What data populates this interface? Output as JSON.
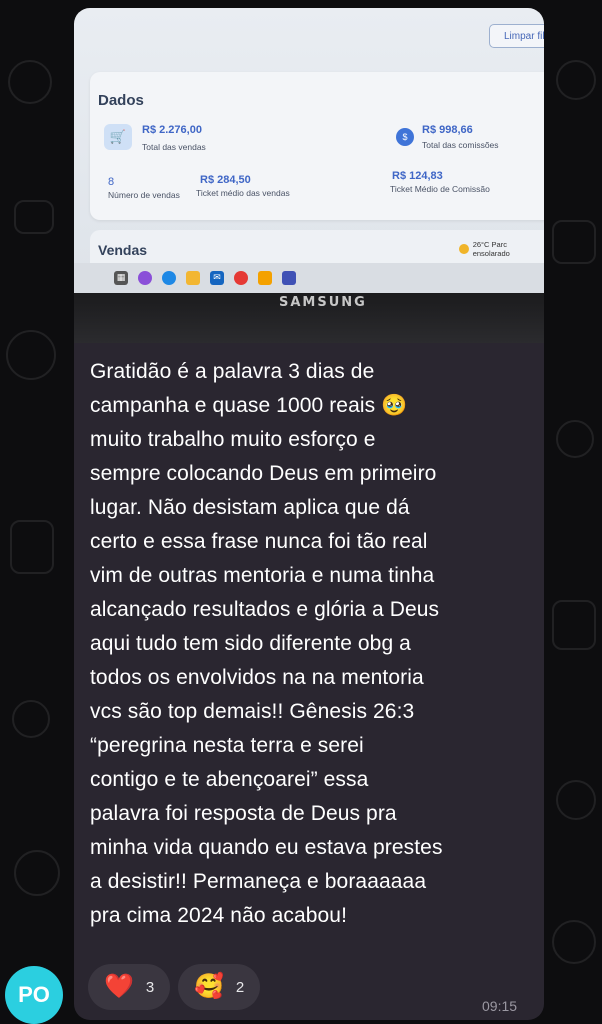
{
  "screen": {
    "filter_button": "Limpar filtro",
    "card_title": "Dados",
    "metrics": {
      "total_sales_value": "R$ 2.276,00",
      "total_sales_label": "Total das vendas",
      "commissions_value": "R$ 998,66",
      "commissions_label": "Total das comissões",
      "sales_count_value": "8",
      "sales_count_label": "Número de vendas",
      "avg_ticket_value": "R$ 284,50",
      "avg_ticket_label": "Ticket médio das vendas",
      "avg_commission_value": "R$ 124,83",
      "avg_commission_label": "Ticket Médio de Comissão"
    },
    "sales_title": "Vendas",
    "weather": "26°C  Parc ensolarado",
    "brand": "SAMSUNG"
  },
  "message": {
    "text": "Gratidão é a palavra 3 dias de\ncampanha e quase 1000 reais 🥹\nmuito trabalho muito esforço e\nsempre colocando Deus em primeiro\nlugar. Não desistam aplica que dá\ncerto e essa frase nunca foi tão real\nvim de outras mentoria e numa tinha\nalcançado resultados e glória a Deus\naqui tudo tem sido diferente obg a\ntodos os envolvidos na na mentoria\nvcs são top demais!! Gênesis 26:3\n“peregrina nesta terra e serei\ncontigo e te abençoarei” essa\npalavra foi resposta de Deus pra\nminha vida quando eu estava prestes\na desistir!! Permaneça e boraaaaaa\npra cima 2024 não acabou!",
    "time": "09:15"
  },
  "reactions": [
    {
      "emoji": "❤️",
      "count": "3"
    },
    {
      "emoji": "🥰",
      "count": "2"
    }
  ],
  "sender": {
    "initials": "PO",
    "avatar_color": "#2bcfe0"
  },
  "colors": {
    "bubble": "#2a2630",
    "background": "#0d0d0f"
  }
}
